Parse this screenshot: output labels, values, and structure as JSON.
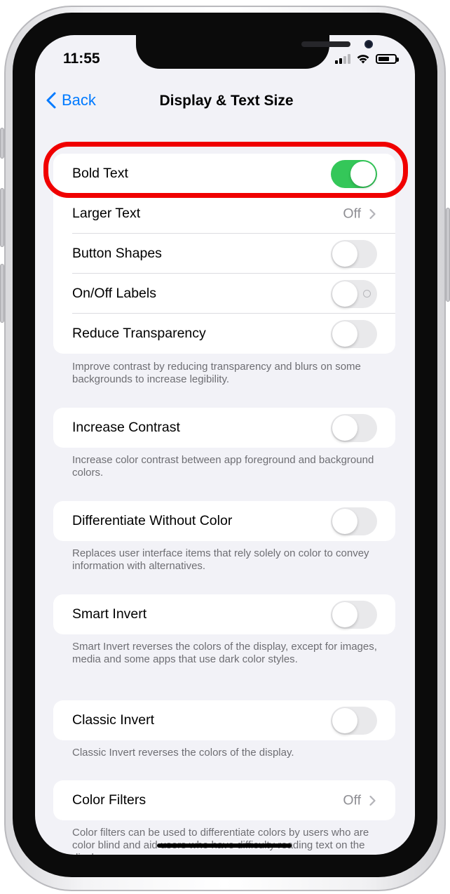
{
  "status_bar": {
    "time": "11:55"
  },
  "nav": {
    "back_label": "Back",
    "title": "Display & Text Size"
  },
  "groups": [
    {
      "rows": [
        {
          "label": "Bold Text",
          "control": "toggle",
          "on": true
        },
        {
          "label": "Larger Text",
          "control": "value",
          "value": "Off"
        },
        {
          "label": "Button Shapes",
          "control": "toggle",
          "on": false
        },
        {
          "label": "On/Off Labels",
          "control": "toggle",
          "on": false
        },
        {
          "label": "Reduce Transparency",
          "control": "toggle",
          "on": false
        }
      ],
      "footer": "Improve contrast by reducing transparency and blurs on some backgrounds to increase legibility."
    },
    {
      "rows": [
        {
          "label": "Increase Contrast",
          "control": "toggle",
          "on": false
        }
      ],
      "footer": "Increase color contrast between app foreground and background colors."
    },
    {
      "rows": [
        {
          "label": "Differentiate Without Color",
          "control": "toggle",
          "on": false
        }
      ],
      "footer": "Replaces user interface items that rely solely on color to convey information with alternatives."
    },
    {
      "rows": [
        {
          "label": "Smart Invert",
          "control": "toggle",
          "on": false
        }
      ],
      "footer": "Smart Invert reverses the colors of the display, except for images, media and some apps that use dark color styles."
    },
    {
      "rows": [
        {
          "label": "Classic Invert",
          "control": "toggle",
          "on": false
        }
      ],
      "footer": "Classic Invert reverses the colors of the display."
    },
    {
      "rows": [
        {
          "label": "Color Filters",
          "control": "value",
          "value": "Off"
        }
      ],
      "footer": "Color filters can be used to differentiate colors by users who are color blind and aid users who have difficulty reading text on the display."
    }
  ],
  "colors": {
    "accent": "#007aff",
    "toggle_on": "#34c759",
    "highlight": "#f00000",
    "background": "#f2f2f7"
  },
  "icons": [
    "back-chevron-icon",
    "signal-icon",
    "wifi-icon",
    "battery-icon",
    "chevron-right-icon"
  ]
}
